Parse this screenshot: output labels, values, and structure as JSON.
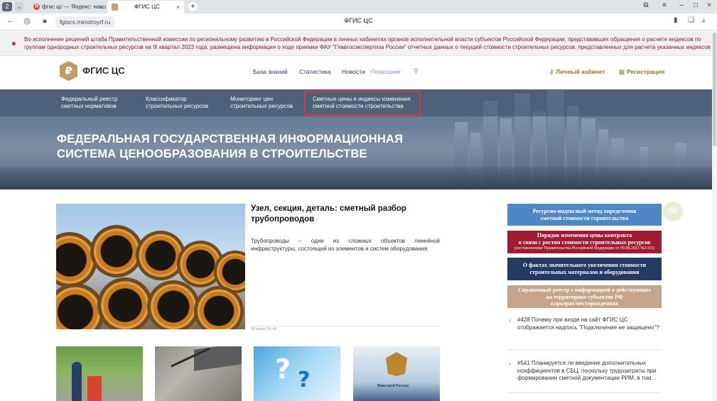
{
  "browser": {
    "tab_count": "2",
    "tabs": [
      {
        "title": "фгис цс — Яндекс: нашлос"
      },
      {
        "title": "ФГИС ЦС"
      }
    ],
    "url": "fgiscs.minstroyrf.ru",
    "page_title": "ФГИС ЦС",
    "icons": {
      "back": "arrow-left",
      "reload": "reload",
      "bookmark": "bookmark",
      "download": "download"
    }
  },
  "notice": {
    "text": "Во исполнение решений штаба Правительственной комиссии по региональному развитию в Российской Федерации в личных кабинетах органов исполнительной власти субъектов Российской Федерации, представивших обращения о расчете индексов по группам однородных строительных ресурсов на III квартал 2023 года, размещена информация о ходе приемки ФАУ \"Главгосэкспертиза России\" отчетных данных о текущей стоимости строительных ресурсов, представленных для расчета указанных индексов"
  },
  "header": {
    "logo_text": "ФГИС ЦС",
    "nav": [
      "База знаний",
      "Статистика",
      "Новости",
      "Помощник"
    ],
    "personal_cabinet": "Личный кабинет",
    "registration": "Регистрация"
  },
  "hero": {
    "menu": [
      {
        "line1": "Федеральный реестр",
        "line2": "сметных нормативов"
      },
      {
        "line1": "Классификатор",
        "line2": "строительных ресурсов"
      },
      {
        "line1": "Мониторинг цен",
        "line2": "строительных ресурсов"
      },
      {
        "line1": "Сметные цены и индексы изменения",
        "line2": "сметной стоимости строительства"
      }
    ],
    "title_line1": "ФЕДЕРАЛЬНАЯ ГОСУДАРСТВЕННАЯ ИНФОРМАЦИОННАЯ",
    "title_line2": "СИСТЕМА ЦЕНООБРАЗОВАНИЯ В СТРОИТЕЛЬСТВЕ"
  },
  "featured": {
    "title": "Узел, секция, деталь: сметный разбор трубопроводов",
    "description": "Трубопроводы – один из сложных объектов линейной инфраструктуры, состоящий из элементов и систем оборудования.",
    "date": "29 июня 16:45"
  },
  "thumbnails": {
    "ministry_caption": "Минстрой России"
  },
  "sidebar": {
    "buttons": [
      {
        "line1": "Ресурсно-индексный метод определения",
        "line2": "сметной стоимости строительства"
      },
      {
        "line1": "Порядок изменения цены контракта",
        "line2": "в связи с ростом стоимости строительных ресурсов",
        "small": "(постановление Правительства Российской Федерации от 09.08.2021 №1315)"
      },
      {
        "line1": "О фактах значительного увеличения стоимости",
        "line2": "строительных материалов и оборудования"
      },
      {
        "line1": "Справочный реестр с информацией о действующих",
        "line2": "на территориях субъектов РФ",
        "line3": "карьерах/месторождениях"
      }
    ],
    "qa": [
      "#428 Почему при входе на сайт ФГИС ЦС отображается надпись \"Подключение не защищено\"?",
      "#541 Планируется ли введение дополнительных коэффициентов в СБЦ, поскольку трудозатраты при формировании сметной документации РИМ, в том..."
    ]
  }
}
